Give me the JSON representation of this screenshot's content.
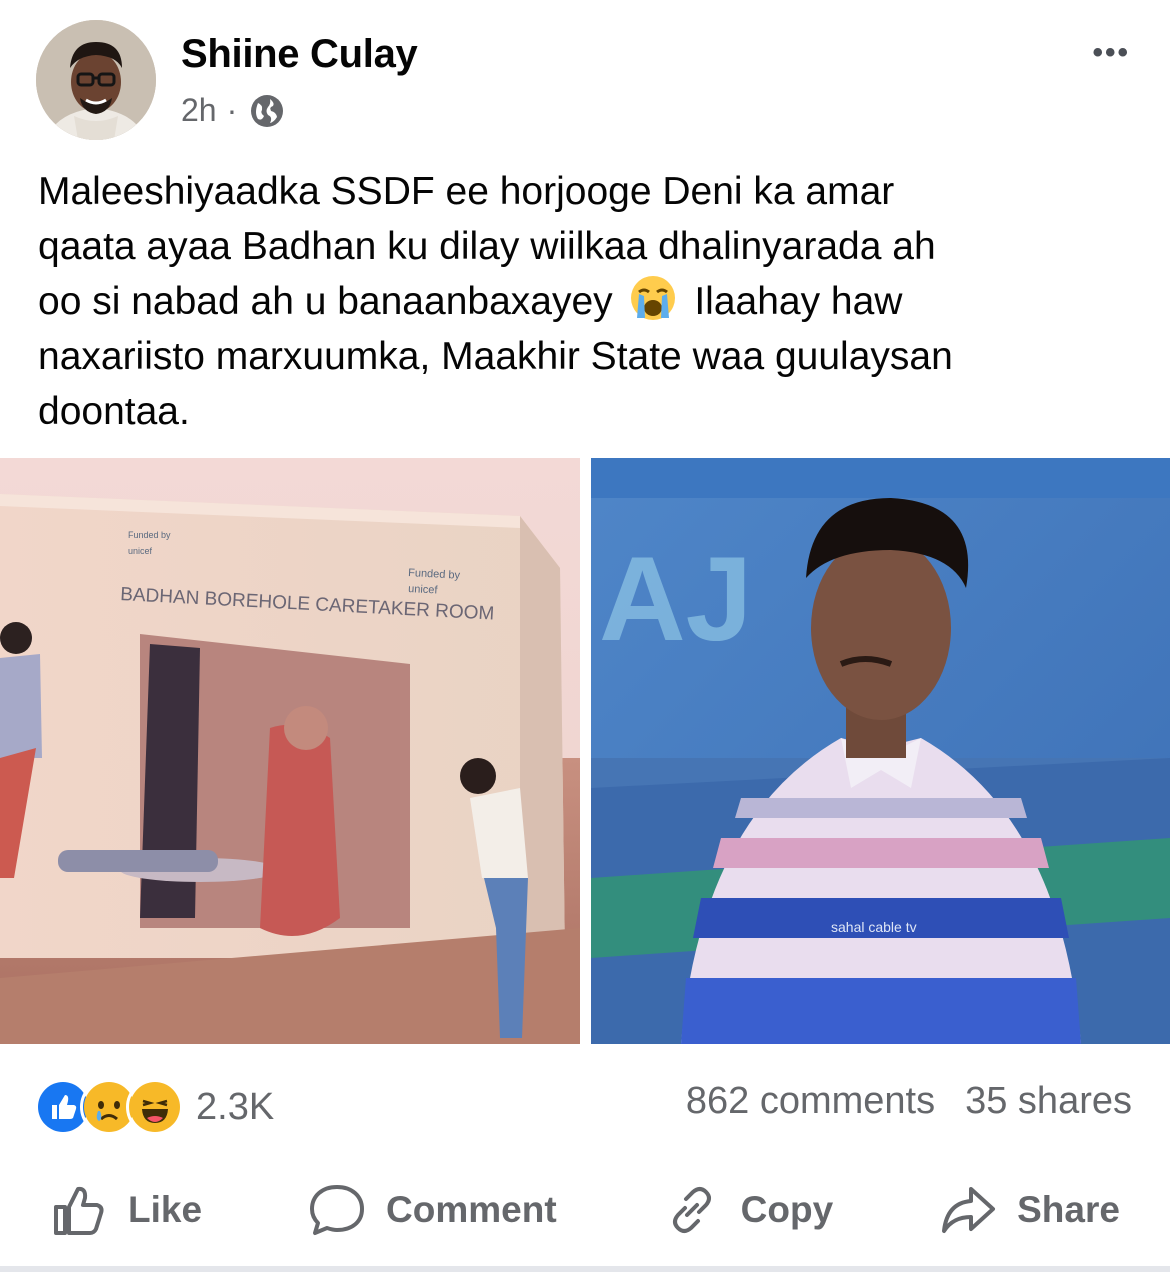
{
  "post": {
    "author": "Shiine Culay",
    "time": "2h",
    "separator": "·",
    "privacy_icon": "globe-icon",
    "more_icon": "more-options-icon",
    "more_label": "•••",
    "text_line1": "Maleeshiyaadka SSDF ee horjooge Deni ka amar",
    "text_line2": "qaata ayaa Badhan ku dilay wiilkaa dhalinyarada ah",
    "text_line3a": "oo si nabad ah u banaanbaxayey",
    "text_line3b": "Ilaahay haw",
    "text_line4": "naxariisto marxuumka, Maakhir State waa guulaysan",
    "text_line5": "doontaa.",
    "emoji": "crying-face-emoji"
  },
  "photos": {
    "left": {
      "sign_main": "BADHAN BOREHOLE CARETAKER ROOM",
      "sign_funded": "Funded by",
      "sign_unicef": "unicef",
      "sign_small1": "Funded by",
      "sign_small2": "unicef"
    },
    "right": {
      "watermark": "sahal cable tv",
      "bg_text": "AJ"
    }
  },
  "engagement": {
    "reaction_icons": [
      "like-reaction-icon",
      "sad-reaction-icon",
      "haha-reaction-icon"
    ],
    "reaction_count": "2.3K",
    "comments": "862 comments",
    "shares": "35 shares"
  },
  "actions": {
    "like": "Like",
    "comment": "Comment",
    "copy": "Copy",
    "share": "Share"
  },
  "colors": {
    "like_blue": "#1877f2",
    "emoji_yellow": "#f7b928",
    "muted_text": "#65676b"
  }
}
